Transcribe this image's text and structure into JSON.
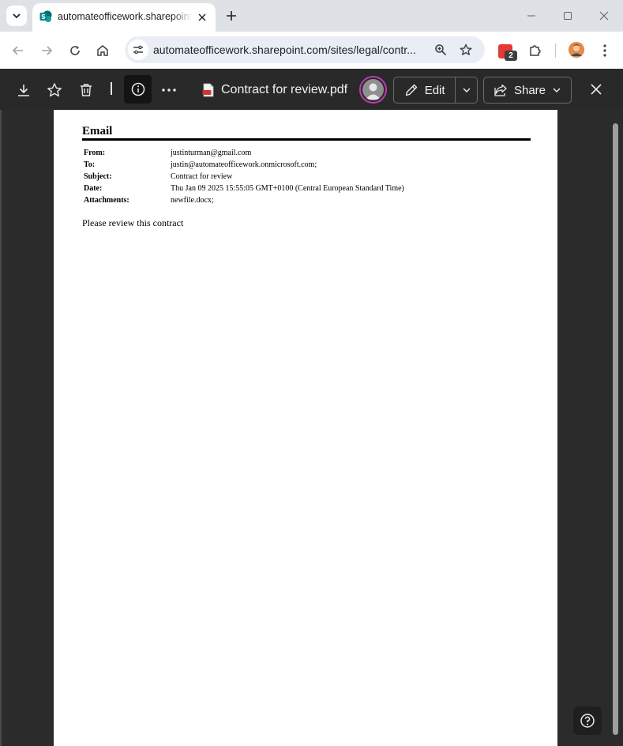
{
  "browser": {
    "tab_title": "automateofficework.sharepoint.com",
    "url": "automateofficework.sharepoint.com/sites/legal/contr...",
    "extension_badge_count": "2"
  },
  "viewer": {
    "file_name": "Contract for review.pdf",
    "edit_label": "Edit",
    "share_label": "Share"
  },
  "email": {
    "heading": "Email",
    "fields": [
      {
        "label": "From:",
        "value": "justinturman@gmail.com"
      },
      {
        "label": "To:",
        "value": "justin@automateofficework.onmicrosoft.com;"
      },
      {
        "label": "Subject:",
        "value": "Contract for review"
      },
      {
        "label": "Date:",
        "value": "Thu Jan 09 2025 15:55:05 GMT+0100 (Central European Standard Time)"
      },
      {
        "label": "Attachments:",
        "value": "newfile.docx;"
      }
    ],
    "body": "Please review this contract"
  },
  "colors": {
    "viewer_bg": "#292929",
    "doc_bg": "#2b2b2b",
    "presence_ring": "#c239b3",
    "sharepoint_teal": "#038387"
  }
}
